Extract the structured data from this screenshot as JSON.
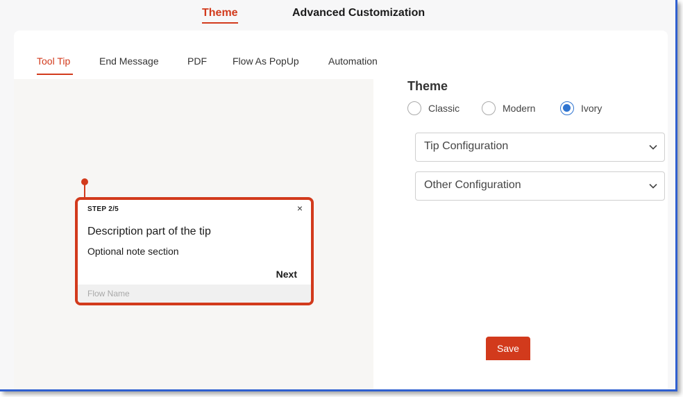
{
  "top_tabs": [
    {
      "label": "Theme",
      "active": true
    },
    {
      "label": "Advanced Customization",
      "active": false
    }
  ],
  "sub_tabs": [
    {
      "label": "Tool Tip",
      "active": true
    },
    {
      "label": "End Message",
      "active": false
    },
    {
      "label": "PDF",
      "active": false
    },
    {
      "label": "Flow As PopUp",
      "active": false
    },
    {
      "label": "Automation",
      "active": false
    }
  ],
  "tooltip": {
    "step": "STEP 2/5",
    "close_glyph": "×",
    "description": "Description part of the tip",
    "note": "Optional note section",
    "next_label": "Next",
    "footer": "Flow Name"
  },
  "settings": {
    "title": "Theme",
    "themes": [
      {
        "label": "Classic",
        "checked": false
      },
      {
        "label": "Modern",
        "checked": false
      },
      {
        "label": "Ivory",
        "checked": true
      }
    ],
    "sections": [
      {
        "label": "Tip Configuration"
      },
      {
        "label": "Other Configuration"
      }
    ]
  },
  "save_label": "Save",
  "colors": {
    "accent": "#d23a1c",
    "radio_checked": "#2f74d0",
    "window_border": "#2f5fd0"
  }
}
